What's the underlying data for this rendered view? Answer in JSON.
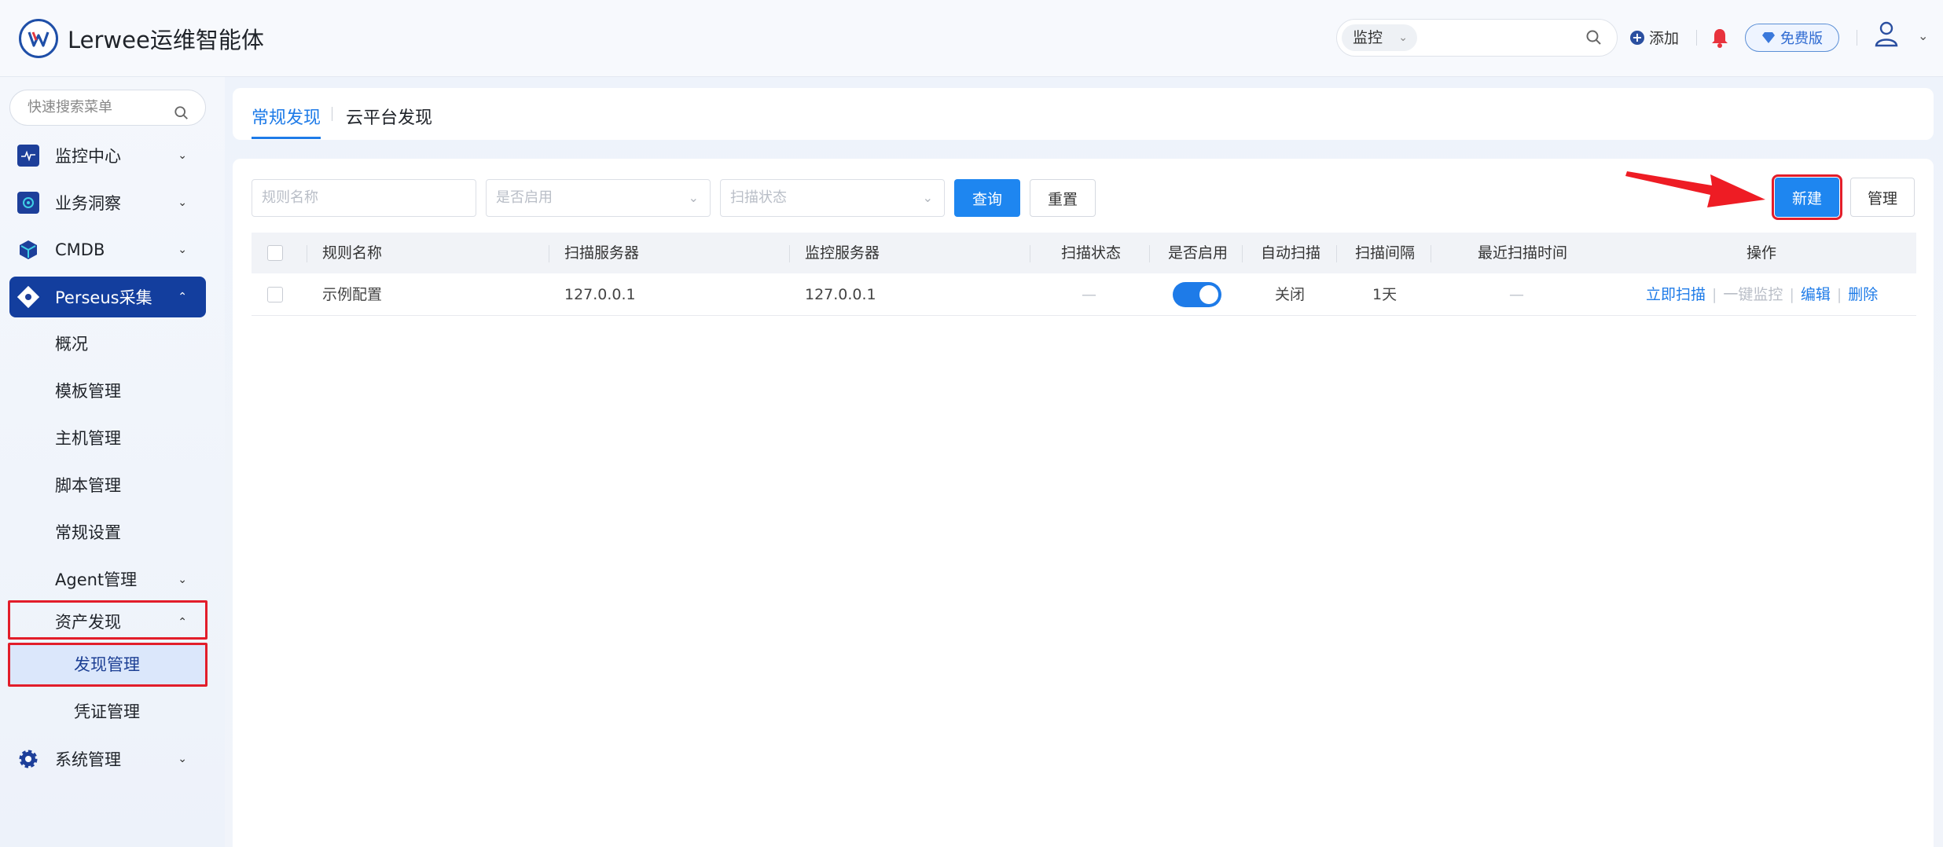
{
  "header": {
    "app_title": "Lerwee运维智能体",
    "search_scope": "监控",
    "add_label": "添加",
    "plan_badge": "免费版"
  },
  "sidebar": {
    "search_placeholder": "快速搜索菜单",
    "items": [
      {
        "label": "监控中心"
      },
      {
        "label": "业务洞察"
      },
      {
        "label": "CMDB"
      },
      {
        "label": "Perseus采集"
      }
    ],
    "sub_items": [
      {
        "label": "概况"
      },
      {
        "label": "模板管理"
      },
      {
        "label": "主机管理"
      },
      {
        "label": "脚本管理"
      },
      {
        "label": "常规设置"
      },
      {
        "label": "Agent管理"
      },
      {
        "label": "资产发现"
      }
    ],
    "sub2_items": [
      {
        "label": "发现管理"
      },
      {
        "label": "凭证管理"
      }
    ],
    "system_item": {
      "label": "系统管理"
    }
  },
  "tabs": [
    {
      "label": "常规发现"
    },
    {
      "label": "云平台发现"
    }
  ],
  "filters": {
    "name_placeholder": "规则名称",
    "enabled_placeholder": "是否启用",
    "status_placeholder": "扫描状态",
    "query_label": "查询",
    "reset_label": "重置",
    "new_label": "新建",
    "manage_label": "管理"
  },
  "table": {
    "headers": {
      "name": "规则名称",
      "scan_server": "扫描服务器",
      "monitor_server": "监控服务器",
      "scan_status": "扫描状态",
      "enabled": "是否启用",
      "auto_scan": "自动扫描",
      "interval": "扫描间隔",
      "last_scan": "最近扫描时间",
      "actions": "操作"
    },
    "rows": [
      {
        "name": "示例配置",
        "scan_server": "127.0.0.1",
        "monitor_server": "127.0.0.1",
        "scan_status": "—",
        "enabled": true,
        "auto_scan": "关闭",
        "interval": "1天",
        "last_scan": "—",
        "actions": {
          "scan_now": "立即扫描",
          "one_click_monitor": "一键监控",
          "edit": "编辑",
          "delete": "删除"
        }
      }
    ]
  },
  "colors": {
    "accent": "#1e7be8",
    "nav_active": "#133e9e",
    "highlight_box": "#e21d2a"
  }
}
